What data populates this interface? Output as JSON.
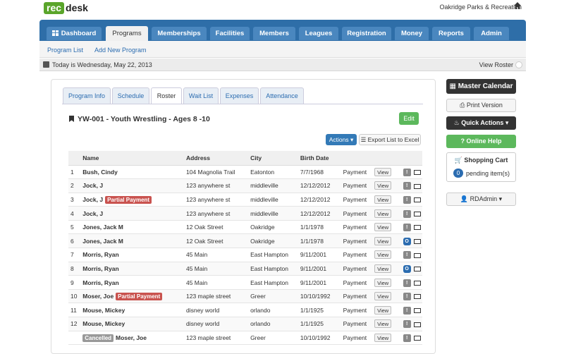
{
  "header": {
    "logo_rec": "rec",
    "logo_desk": "desk",
    "org_name": "Oakridge Parks & Recreation"
  },
  "nav": {
    "tabs": [
      {
        "label": "Dashboard"
      },
      {
        "label": "Programs"
      },
      {
        "label": "Memberships"
      },
      {
        "label": "Facilities"
      },
      {
        "label": "Members"
      },
      {
        "label": "Leagues"
      },
      {
        "label": "Registration"
      },
      {
        "label": "Money"
      },
      {
        "label": "Reports"
      },
      {
        "label": "Admin"
      }
    ],
    "active": "Programs"
  },
  "subnav": {
    "program_list": "Program List",
    "add_new": "Add New Program"
  },
  "datebar": {
    "date_text": "Today is Wednesday, May 22, 2013",
    "view_roster": "View Roster"
  },
  "program_tabs": [
    {
      "label": "Program Info"
    },
    {
      "label": "Schedule"
    },
    {
      "label": "Roster"
    },
    {
      "label": "Wait List"
    },
    {
      "label": "Expenses"
    },
    {
      "label": "Attendance"
    }
  ],
  "program": {
    "title": "YW-001 - Youth Wrestling - Ages 8 -10",
    "edit_label": "Edit",
    "actions_label": "Actions",
    "export_label": "Export List to Excel"
  },
  "table": {
    "headers": [
      "Name",
      "Address",
      "City",
      "Birth Date"
    ],
    "rows": [
      {
        "num": "1",
        "name": "Bush, Cindy",
        "badge": "",
        "address": "104 Magnolia Trail",
        "city": "Eatonton",
        "birth": "7/7/1968",
        "payment": "Payment",
        "view": "View",
        "icon": "!"
      },
      {
        "num": "2",
        "name": "Jock, J",
        "badge": "",
        "address": "123 anywhere st",
        "city": "middleville",
        "birth": "12/12/2012",
        "payment": "Payment",
        "view": "View",
        "icon": "!"
      },
      {
        "num": "3",
        "name": "Jock, J",
        "badge": "Partial Payment",
        "address": "123 anywhere st",
        "city": "middleville",
        "birth": "12/12/2012",
        "payment": "Payment",
        "view": "View",
        "icon": "!"
      },
      {
        "num": "4",
        "name": "Jock, J",
        "badge": "",
        "address": "123 anywhere st",
        "city": "middleville",
        "birth": "12/12/2012",
        "payment": "Payment",
        "view": "View",
        "icon": "!"
      },
      {
        "num": "5",
        "name": "Jones, Jack M",
        "badge": "",
        "address": "12 Oak Street",
        "city": "Oakridge",
        "birth": "1/1/1978",
        "payment": "Payment",
        "view": "View",
        "icon": "!"
      },
      {
        "num": "6",
        "name": "Jones, Jack M",
        "badge": "",
        "address": "12 Oak Street",
        "city": "Oakridge",
        "birth": "1/1/1978",
        "payment": "Payment",
        "view": "View",
        "icon": "O"
      },
      {
        "num": "7",
        "name": "Morris, Ryan",
        "badge": "",
        "address": "45 Main",
        "city": "East Hampton",
        "birth": "9/11/2001",
        "payment": "Payment",
        "view": "View",
        "icon": "!"
      },
      {
        "num": "8",
        "name": "Morris, Ryan",
        "badge": "",
        "address": "45 Main",
        "city": "East Hampton",
        "birth": "9/11/2001",
        "payment": "Payment",
        "view": "View",
        "icon": "O"
      },
      {
        "num": "9",
        "name": "Morris, Ryan",
        "badge": "",
        "address": "45 Main",
        "city": "East Hampton",
        "birth": "9/11/2001",
        "payment": "Payment",
        "view": "View",
        "icon": "!"
      },
      {
        "num": "10",
        "name": "Moser, Joe",
        "badge": "Partial Payment",
        "address": "123 maple street",
        "city": "Greer",
        "birth": "10/10/1992",
        "payment": "Payment",
        "view": "View",
        "icon": "!"
      },
      {
        "num": "11",
        "name": "Mouse, Mickey",
        "badge": "",
        "address": "disney world",
        "city": "orlando",
        "birth": "1/1/1925",
        "payment": "Payment",
        "view": "View",
        "icon": "!"
      },
      {
        "num": "12",
        "name": "Mouse, Mickey",
        "badge": "",
        "address": "disney world",
        "city": "orlando",
        "birth": "1/1/1925",
        "payment": "Payment",
        "view": "View",
        "icon": "!"
      },
      {
        "num": "",
        "name": "Moser, Joe",
        "badge": "",
        "cancelled": "Cancelled",
        "address": "123 maple street",
        "city": "Greer",
        "birth": "10/10/1992",
        "payment": "Payment",
        "view": "View",
        "icon": "!"
      }
    ]
  },
  "sidebar": {
    "master_calendar": "Master Calendar",
    "print_version": "Print Version",
    "quick_actions": "Quick Actions",
    "online_help": "Online Help",
    "shopping_cart": "Shopping Cart",
    "cart_count": "0",
    "pending_items": "pending item(s)",
    "user": "RDAdmin"
  },
  "colors": {
    "nav_bg": "#2e6ea8",
    "brand_green": "#5aa52b",
    "link_blue": "#2b6cb0",
    "partial_badge": "#c9534f"
  }
}
